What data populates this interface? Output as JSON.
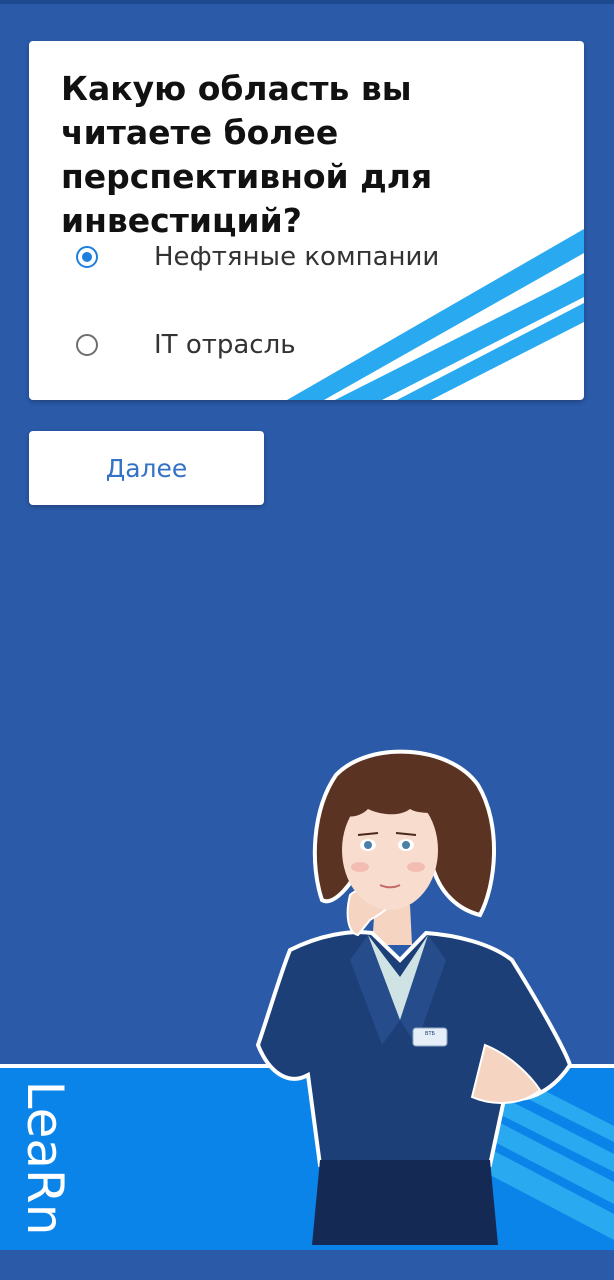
{
  "quiz": {
    "question": "Какую область вы читаете более перспективной для инвестиций?",
    "options": [
      {
        "label": "Нефтяные компании",
        "selected": true
      },
      {
        "label": "IT отрасль",
        "selected": false
      }
    ],
    "next_label": "Далее"
  },
  "branding": {
    "logo_text": "LeaRn",
    "badge_text": "ВТБ"
  },
  "colors": {
    "background": "#2a5aa8",
    "accent": "#1f7fe0",
    "stripe": "#29a9f0",
    "banner": "#0b84ea"
  }
}
